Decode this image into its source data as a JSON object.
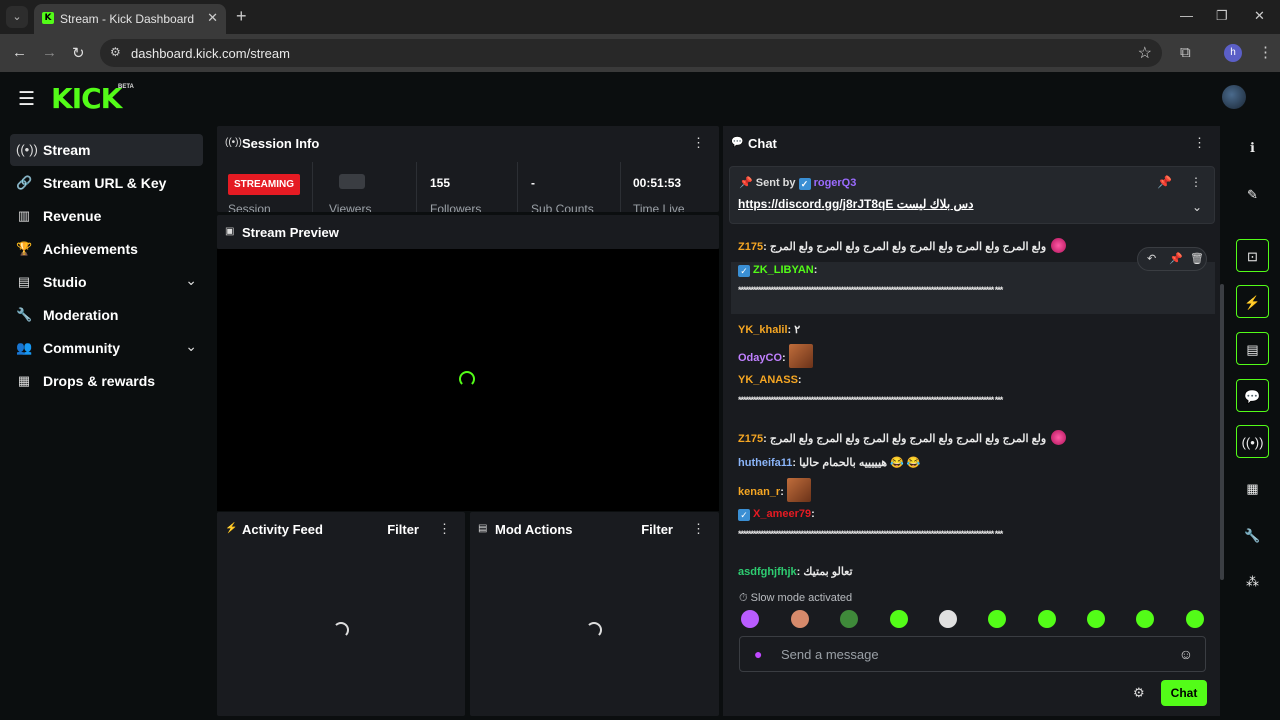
{
  "browser": {
    "tab_title": "Stream - Kick Dashboard",
    "url": "dashboard.kick.com/stream",
    "profile_initial": "h"
  },
  "brand": {
    "logo": "KICK",
    "beta": "BETA",
    "accent": "#53fc18"
  },
  "sidebar": {
    "items": [
      {
        "label": "Stream",
        "icon": "broadcast-icon",
        "active": true
      },
      {
        "label": "Stream URL & Key",
        "icon": "link-icon"
      },
      {
        "label": "Revenue",
        "icon": "chart-icon"
      },
      {
        "label": "Achievements",
        "icon": "trophy-icon"
      },
      {
        "label": "Studio",
        "icon": "studio-icon",
        "expandable": true
      },
      {
        "label": "Moderation",
        "icon": "wrench-icon"
      },
      {
        "label": "Community",
        "icon": "community-icon",
        "expandable": true
      },
      {
        "label": "Drops & rewards",
        "icon": "drops-icon"
      }
    ]
  },
  "session": {
    "title": "Session Info",
    "status": "STREAMING",
    "status_label": "Session",
    "viewers_label": "Viewers",
    "followers_value": "155",
    "followers_label": "Followers",
    "subs_value": "-",
    "subs_label": "Sub Counts",
    "time_value": "00:51:53",
    "time_label": "Time Live"
  },
  "preview": {
    "title": "Stream Preview"
  },
  "activity": {
    "title": "Activity Feed",
    "filter": "Filter"
  },
  "mod": {
    "title": "Mod Actions",
    "filter": "Filter"
  },
  "chat": {
    "title": "Chat",
    "pinned": {
      "sent_by": "Sent by",
      "user": "rogerQ3",
      "text": "https://discord.gg/j8rJT8qE دس بلاك ليست"
    },
    "messages": [
      {
        "user": "Z175",
        "color": "#f5a623",
        "text": "ولع المرج ولع المرج ولع المرج ولع المرج ولع المرج ولع المرج"
      },
      {
        "user": "ZK_LIBYAN",
        "color": "#53fc18",
        "verified": true,
        "text": "****************************************************************************************************** ***"
      },
      {
        "user": "YK_khalil",
        "color": "#f5a623",
        "text": "٢"
      },
      {
        "user": "OdayCO",
        "color": "#c080ff",
        "text": ""
      },
      {
        "user": "YK_ANASS",
        "color": "#f5a623",
        "text": "****************************************************************************************************** ***"
      },
      {
        "user": "Z175",
        "color": "#f5a623",
        "text": "ولع المرج ولع المرج ولع المرج ولع المرج ولع المرج ولع المرج"
      },
      {
        "user": "hutheifa11",
        "color": "#8ab4f8",
        "text": "هيييييه بالحمام حاليا 😂 😂"
      },
      {
        "user": "kenan_r",
        "color": "#f5a623",
        "text": ""
      },
      {
        "user": "X_ameer79",
        "color": "#e51b23",
        "verified": true,
        "text": "****************************************************************************************************** ***"
      },
      {
        "user": "asdfghjfhjk",
        "color": "#2ecc71",
        "text": "تعالو بمتيك"
      }
    ],
    "slow_mode": "Slow mode activated",
    "input_placeholder": "Send a message",
    "send_label": "Chat"
  }
}
